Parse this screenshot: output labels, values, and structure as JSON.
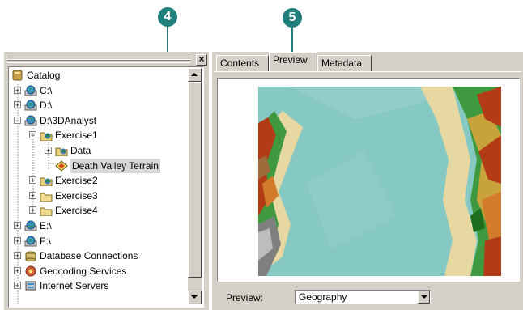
{
  "callouts": {
    "left": "4",
    "right": "5"
  },
  "catalog": {
    "items": [
      {
        "label": "Catalog",
        "icon": "catalog-icon",
        "depth": 0,
        "expander": ""
      },
      {
        "label": "C:\\",
        "icon": "drive-globe-icon",
        "depth": 1,
        "expander": "+"
      },
      {
        "label": "D:\\",
        "icon": "drive-globe-icon",
        "depth": 1,
        "expander": "+"
      },
      {
        "label": "D:\\3DAnalyst",
        "icon": "drive-globe-icon",
        "depth": 1,
        "expander": "−"
      },
      {
        "label": "Exercise1",
        "icon": "folder-3d-icon",
        "depth": 2,
        "expander": "−"
      },
      {
        "label": "Data",
        "icon": "folder-3d-icon",
        "depth": 3,
        "expander": "+"
      },
      {
        "label": "Death Valley Terrain",
        "icon": "tin-icon",
        "depth": 3,
        "expander": ""
      },
      {
        "label": "Exercise2",
        "icon": "folder-3d-icon",
        "depth": 2,
        "expander": "+"
      },
      {
        "label": "Exercise3",
        "icon": "folder-icon",
        "depth": 2,
        "expander": "+"
      },
      {
        "label": "Exercise4",
        "icon": "folder-icon",
        "depth": 2,
        "expander": "+"
      },
      {
        "label": "E:\\",
        "icon": "drive-globe-icon",
        "depth": 1,
        "expander": "+"
      },
      {
        "label": "F:\\",
        "icon": "drive-globe-icon",
        "depth": 1,
        "expander": "+"
      },
      {
        "label": "Database Connections",
        "icon": "database-icon",
        "depth": 1,
        "expander": "+"
      },
      {
        "label": "Geocoding Services",
        "icon": "geocoding-icon",
        "depth": 1,
        "expander": "+"
      },
      {
        "label": "Internet Servers",
        "icon": "server-icon",
        "depth": 1,
        "expander": "+"
      }
    ]
  },
  "tabs": {
    "contents": "Contents",
    "preview": "Preview",
    "metadata": "Metadata"
  },
  "preview_bar": {
    "label": "Preview:",
    "selected": "Geography"
  },
  "colors": {
    "callout": "#1f7f7a",
    "chrome": "#d4d0c8",
    "lake": "#7fc4c0",
    "shore": "#e6d8a0"
  }
}
